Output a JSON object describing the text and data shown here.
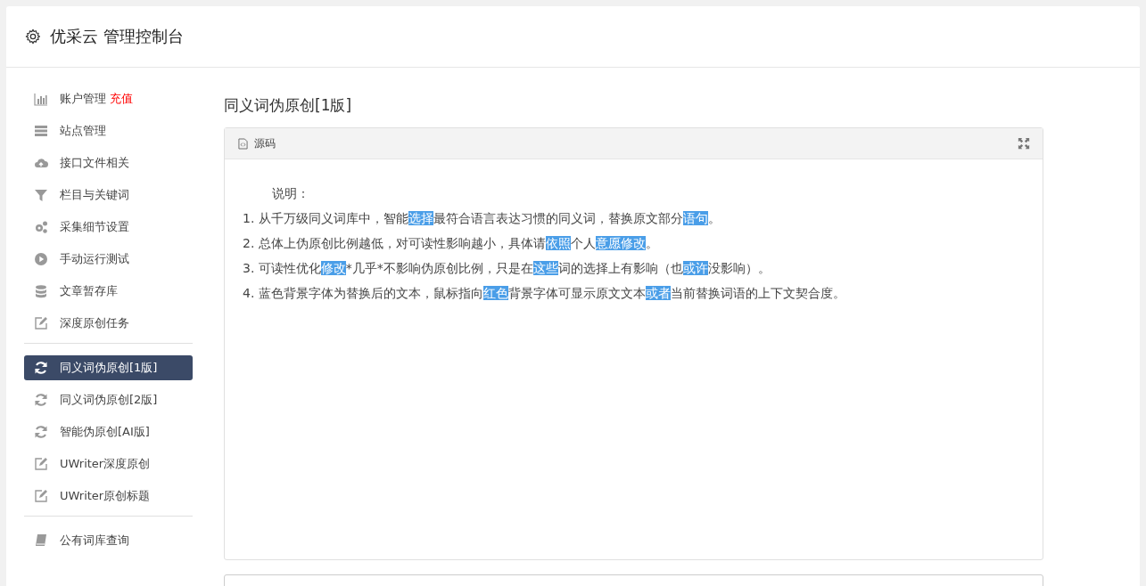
{
  "header": {
    "title": "优采云 管理控制台"
  },
  "sidebar": {
    "groups": [
      {
        "items": [
          {
            "label": "账户管理",
            "badge": "充值",
            "selected": false
          },
          {
            "label": "站点管理",
            "selected": false
          },
          {
            "label": "接口文件相关",
            "selected": false
          },
          {
            "label": "栏目与关键词",
            "selected": false
          },
          {
            "label": "采集细节设置",
            "selected": false
          },
          {
            "label": "手动运行测试",
            "selected": false
          },
          {
            "label": "文章暂存库",
            "selected": false
          },
          {
            "label": "深度原创任务",
            "selected": false
          }
        ]
      },
      {
        "items": [
          {
            "label": "同义词伪原创[1版]",
            "selected": true
          },
          {
            "label": "同义词伪原创[2版]",
            "selected": false
          },
          {
            "label": "智能伪原创[AI版]",
            "selected": false
          },
          {
            "label": "UWriter深度原创",
            "selected": false
          },
          {
            "label": "UWriter原创标题",
            "selected": false
          }
        ]
      },
      {
        "items": [
          {
            "label": "公有词库查询",
            "selected": false
          }
        ]
      }
    ]
  },
  "page_title": "同义词伪原创[1版]",
  "panel": {
    "title": "源码",
    "heading": "说明：",
    "lines": [
      [
        {
          "text": "1. 从千万级同义词库中，智能",
          "highlight": false
        },
        {
          "text": "选择",
          "highlight": true
        },
        {
          "text": "最符合语言表达习惯的同义词，替换原文部分",
          "highlight": false
        },
        {
          "text": "语句",
          "highlight": true
        },
        {
          "text": "。",
          "highlight": false
        }
      ],
      [
        {
          "text": "2. 总体上伪原创比例越低，对可读性影响越小，具体请",
          "highlight": false
        },
        {
          "text": "依照",
          "highlight": true
        },
        {
          "text": "个人",
          "highlight": false
        },
        {
          "text": "意愿",
          "highlight": true
        },
        {
          "text": "修改",
          "highlight": true
        },
        {
          "text": "。",
          "highlight": false
        }
      ],
      [
        {
          "text": "3. 可读性优化",
          "highlight": false
        },
        {
          "text": "修改",
          "highlight": true
        },
        {
          "text": "*几乎*不影响伪原创比例，只是在",
          "highlight": false
        },
        {
          "text": "这些",
          "highlight": true
        },
        {
          "text": "词的选择上有影响（也",
          "highlight": false
        },
        {
          "text": "或许",
          "highlight": true
        },
        {
          "text": "没影响）。",
          "highlight": false
        }
      ],
      [
        {
          "text": "4. 蓝色背景字体为替换后的文本，鼠标指向",
          "highlight": false
        },
        {
          "text": "红色",
          "highlight": true
        },
        {
          "text": "背景字体可显示原文文本",
          "highlight": false
        },
        {
          "text": "或者",
          "highlight": true
        },
        {
          "text": "当前替换词语的上下文契合度。",
          "highlight": false
        }
      ]
    ]
  }
}
